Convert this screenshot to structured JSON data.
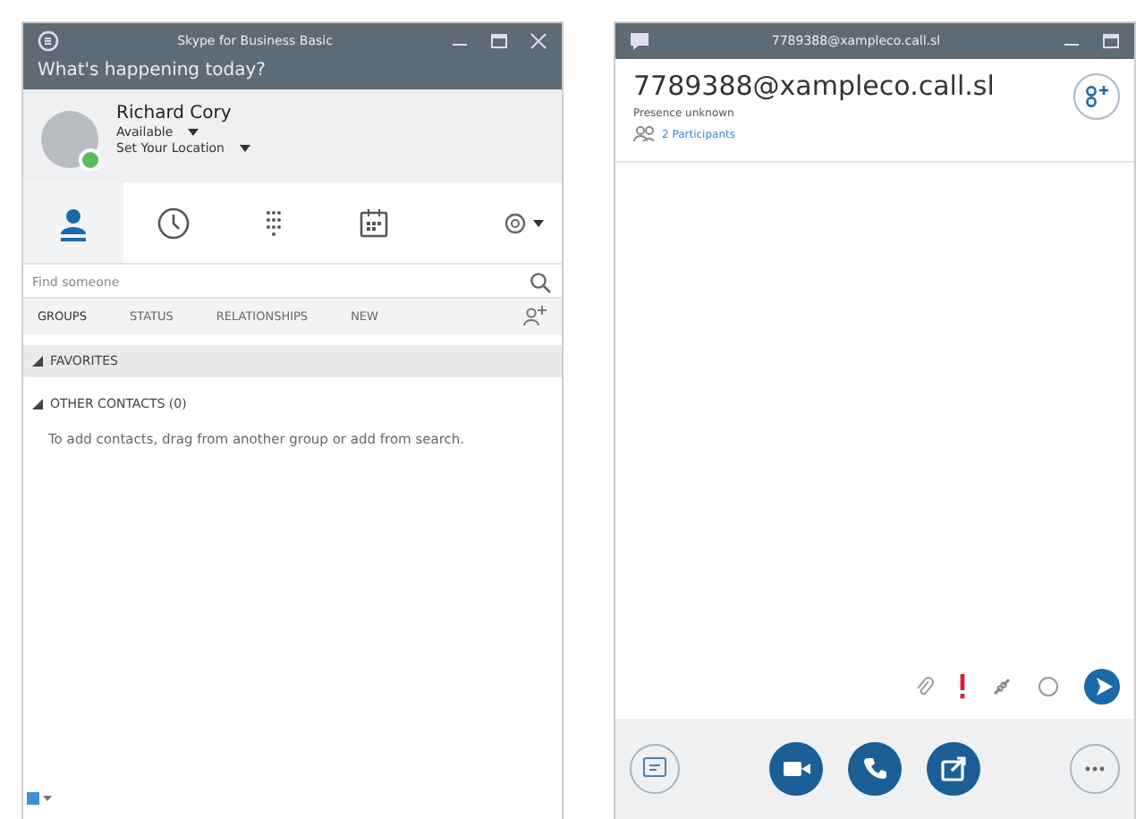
{
  "main_window": {
    "title": "Skype for Business Basic",
    "banner": "What's happening today?",
    "user": {
      "name": "Richard Cory",
      "status": "Available",
      "location": "Set Your Location",
      "online": true
    },
    "nav_tabs": [
      {
        "kind": "contacts",
        "selected": true
      },
      {
        "kind": "recent",
        "selected": false
      },
      {
        "kind": "dialpad",
        "selected": false
      },
      {
        "kind": "meetings",
        "selected": false
      }
    ],
    "search": {
      "placeholder": "Find someone"
    },
    "filter_tabs": [
      {
        "label": "GROUPS",
        "selected": true
      },
      {
        "label": "STATUS",
        "selected": false
      },
      {
        "label": "RELATIONSHIPS",
        "selected": false
      },
      {
        "label": "NEW",
        "selected": false
      }
    ],
    "groups": [
      {
        "label": "FAVORITES",
        "expanded": true,
        "selected": true
      },
      {
        "label": "OTHER CONTACTS (0)",
        "expanded": true,
        "selected": false
      }
    ],
    "hint": "To add contacts, drag from another group or add from search."
  },
  "conversation_window": {
    "title": "7789388@xampleco.call.sl",
    "contact": "7789388@xampleco.call.sl",
    "presence": "Presence unknown",
    "participants": "2 Participants"
  }
}
